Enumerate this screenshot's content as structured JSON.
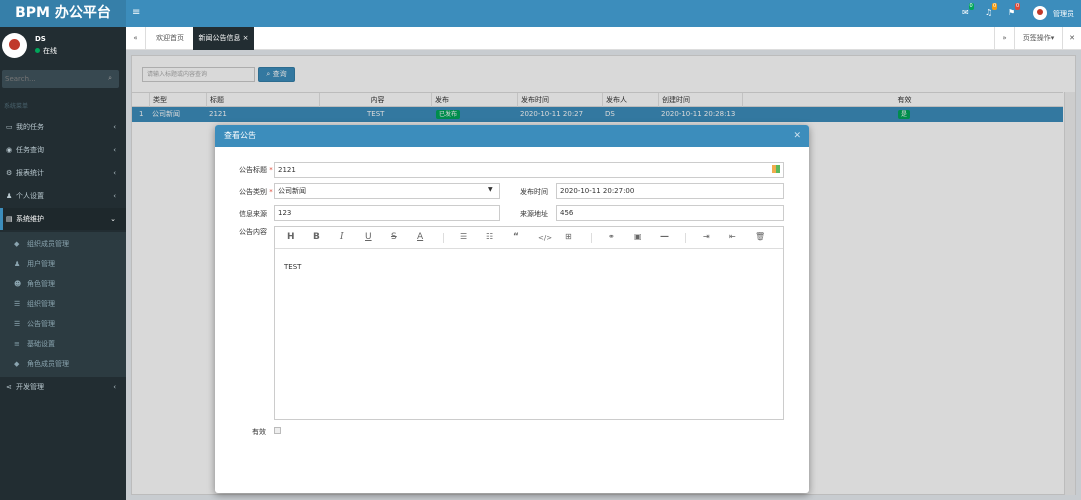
{
  "app": {
    "title": "BPM 办公平台",
    "user": "管理员"
  },
  "notifications": {
    "mail": "0",
    "bell": "0",
    "flag": "0"
  },
  "sidebar": {
    "user_name": "DS",
    "user_status": "在线",
    "search_placeholder": "Search...",
    "header": "系统菜单",
    "items": [
      {
        "label": "我的任务",
        "icon": "desktop-icon"
      },
      {
        "label": "任务查询",
        "icon": "eye-icon"
      },
      {
        "label": "报表统计",
        "icon": "gears-icon"
      },
      {
        "label": "个人设置",
        "icon": "user-icon"
      },
      {
        "label": "系统维护",
        "icon": "book-icon"
      },
      {
        "label": "开发管理",
        "icon": "share-icon"
      }
    ],
    "subitems": [
      {
        "label": "组织成员管理",
        "icon": "tag-icon"
      },
      {
        "label": "用户管理",
        "icon": "user-icon"
      },
      {
        "label": "角色管理",
        "icon": "users-icon"
      },
      {
        "label": "组织管理",
        "icon": "list-icon"
      },
      {
        "label": "公告管理",
        "icon": "list-icon"
      },
      {
        "label": "基础设置",
        "icon": "bars-icon"
      },
      {
        "label": "角色成员管理",
        "icon": "tag-icon"
      }
    ]
  },
  "tabs": {
    "home": "欢迎首页",
    "active": "新闻公告信息 ×",
    "ops": "页签操作▾"
  },
  "search": {
    "placeholder": "请输入标题或内容查询",
    "button": "查询"
  },
  "table": {
    "headers": [
      "类型",
      "标题",
      "内容",
      "发布",
      "发布时间",
      "发布人",
      "创建时间",
      "有效"
    ],
    "row": {
      "index": "1",
      "type": "公司新闻",
      "title": "2121",
      "content": "TEST",
      "published": "已发布",
      "publish_time": "2020-10-11 20:27",
      "publisher": "DS",
      "created": "2020-10-11 20:28:13",
      "valid": "是"
    }
  },
  "modal": {
    "title": "查看公告",
    "labels": {
      "title": "公告标题",
      "category": "公告类别",
      "publish_time": "发布时间",
      "source": "信息来源",
      "source_url": "来源地址",
      "content": "公告内容",
      "valid": "有效"
    },
    "values": {
      "title": "2121",
      "category": "公司新闻",
      "publish_time": "2020-10-11 20:27:00",
      "source": "123",
      "source_url": "456",
      "content": "TEST"
    }
  },
  "colors": {
    "primary": "#3c8dbc",
    "sidebar": "#222d32",
    "success": "#00a65a",
    "danger": "#dd4b39"
  }
}
